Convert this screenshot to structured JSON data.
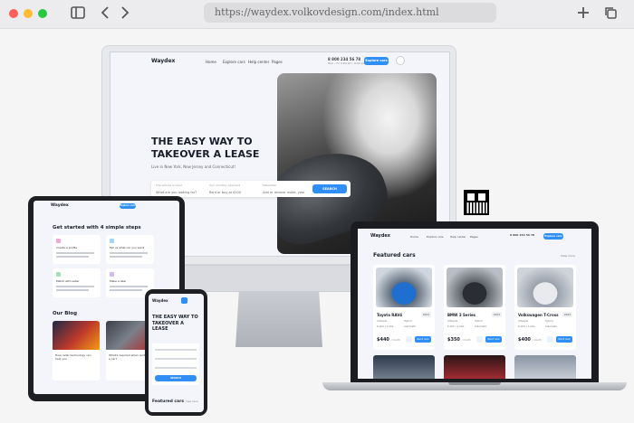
{
  "browser": {
    "url": "https://waydex.volkovdesign.com/index.html"
  },
  "site": {
    "logo": "Waydex",
    "nav": [
      "Home",
      "Explore cars",
      "Help center",
      "Pages"
    ],
    "phone": "8 800 234 56 78",
    "phone_sub": "Mon - Fri 9:00 am - 6:00 pm",
    "cta": "Explore cars",
    "hero_title": "THE EASY WAY TO TAKEOVER A LEASE",
    "hero_subtitle": "Live in New York, New Jersey and Connecticut!",
    "search_fields": [
      {
        "label": "The vehicle is free?",
        "value": "What are you looking for?"
      },
      {
        "label": "Your monthly payment",
        "value": "Rent or buy at $100"
      },
      {
        "label": "Make/Year",
        "value": "Add or recover make, year"
      }
    ],
    "search_button": "SEARCH"
  },
  "tablet": {
    "steps_title": "Get started with 4 simple steps",
    "steps": [
      "Create a profile",
      "Tell us what car you want",
      "Match with seller",
      "Make a deal"
    ],
    "blog_title": "Our Blog",
    "posts": [
      "How radar technology can help you",
      "What's required when renting a car?"
    ]
  },
  "laptop": {
    "section_title": "Featured cars",
    "view_more": "View more",
    "cars": [
      {
        "name": "Toyota RAV4",
        "year": "2023",
        "price": "$440",
        "unit": "/ month",
        "book": "Rent now",
        "color": "#1f6fd1"
      },
      {
        "name": "BMW 3 Series",
        "year": "2023",
        "price": "$350",
        "unit": "/ month",
        "book": "Rent now",
        "color": "#2a2d33"
      },
      {
        "name": "Volkswagen T-Cross",
        "year": "2023",
        "price": "$400",
        "unit": "/ month",
        "book": "Rent now",
        "color": "#e9eaed"
      }
    ],
    "specs": [
      "4 People",
      "Hybrid",
      "6.1km / 1-litre",
      "Automatic"
    ]
  },
  "phone": {
    "hero_title": "THE EASY WAY TO TAKEOVER A LEASE",
    "search_button": "SEARCH",
    "featured_title": "Featured cars",
    "view_more": "View more"
  },
  "colors": {
    "accent": "#2f8ff6"
  }
}
